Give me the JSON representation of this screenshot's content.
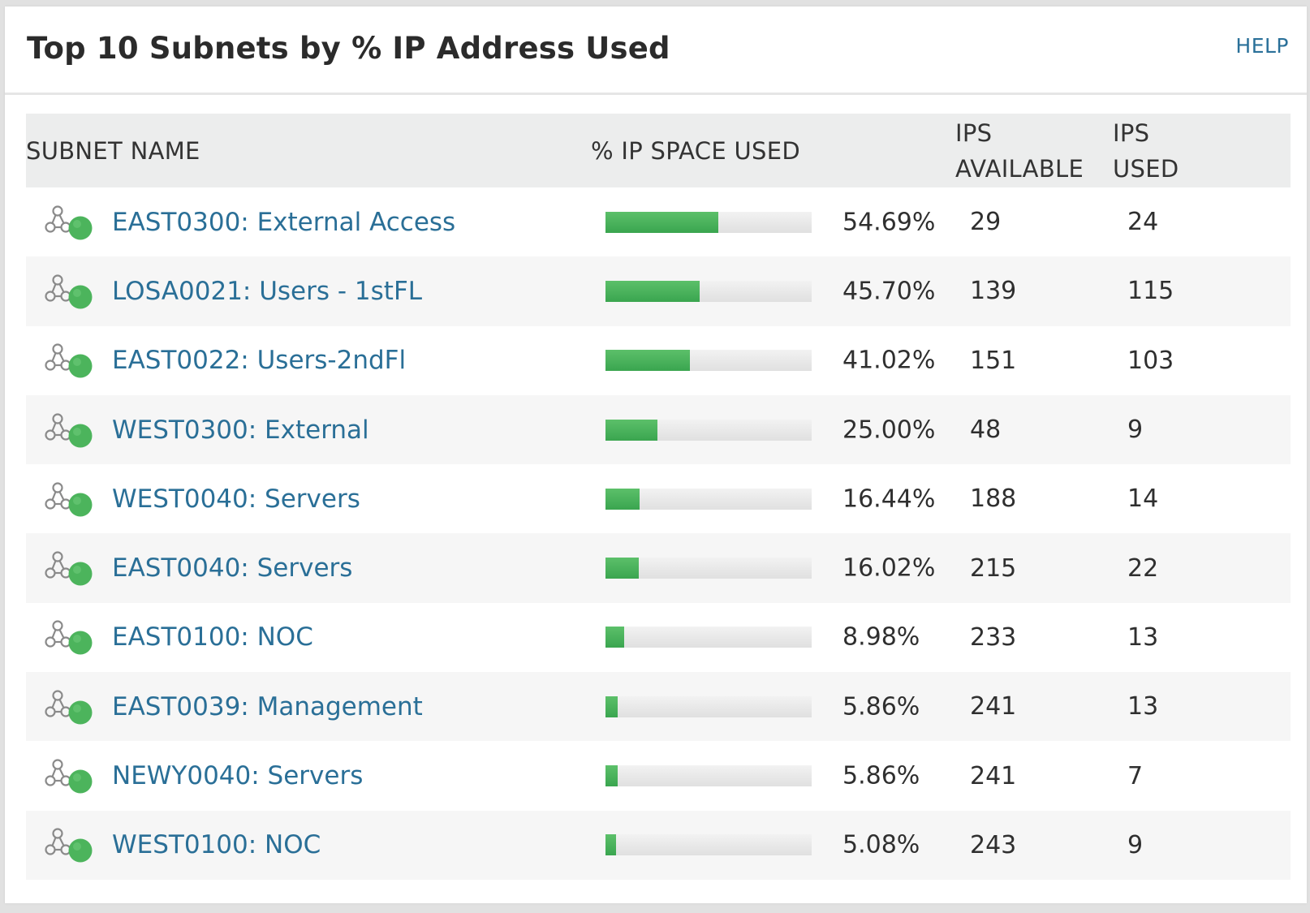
{
  "panel": {
    "title": "Top 10 Subnets by % IP Address Used",
    "help_label": "HELP"
  },
  "table": {
    "headers": {
      "subnet_name": "SUBNET NAME",
      "pct_used": "% IP SPACE USED",
      "ips_available": [
        "IPS",
        "AVAILABLE"
      ],
      "ips_used": [
        "IPS",
        "USED"
      ]
    },
    "rows": [
      {
        "name": "EAST0300: External Access",
        "pct": 54.69,
        "pct_label": "54.69%",
        "available": "29",
        "used": "24"
      },
      {
        "name": "LOSA0021: Users - 1stFL",
        "pct": 45.7,
        "pct_label": "45.70%",
        "available": "139",
        "used": "115"
      },
      {
        "name": "EAST0022: Users-2ndFl",
        "pct": 41.02,
        "pct_label": "41.02%",
        "available": "151",
        "used": "103"
      },
      {
        "name": "WEST0300: External",
        "pct": 25.0,
        "pct_label": "25.00%",
        "available": "48",
        "used": "9"
      },
      {
        "name": "WEST0040: Servers",
        "pct": 16.44,
        "pct_label": "16.44%",
        "available": "188",
        "used": "14"
      },
      {
        "name": "EAST0040: Servers",
        "pct": 16.02,
        "pct_label": "16.02%",
        "available": "215",
        "used": "22"
      },
      {
        "name": "EAST0100: NOC",
        "pct": 8.98,
        "pct_label": "8.98%",
        "available": "233",
        "used": "13"
      },
      {
        "name": "EAST0039: Management",
        "pct": 5.86,
        "pct_label": "5.86%",
        "available": "241",
        "used": "13"
      },
      {
        "name": "NEWY0040: Servers",
        "pct": 5.86,
        "pct_label": "5.86%",
        "available": "241",
        "used": "7"
      },
      {
        "name": "WEST0100: NOC",
        "pct": 5.08,
        "pct_label": "5.08%",
        "available": "243",
        "used": "9"
      }
    ]
  },
  "icons": {
    "subnet": "subnet-status-up-icon"
  },
  "colors": {
    "link": "#2a6f97",
    "bar_fill": "#43ad56",
    "bar_track": "#e5e5e5",
    "status_up": "#4cb45c"
  }
}
